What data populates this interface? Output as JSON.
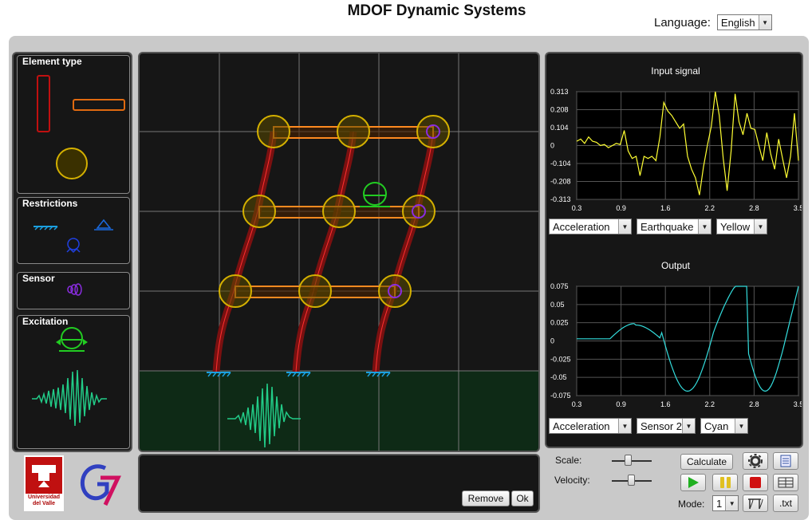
{
  "app": {
    "title": "MDOF Dynamic Systems"
  },
  "language": {
    "label": "Language:",
    "value": "English"
  },
  "left_panel": {
    "element_type": "Element type",
    "restrictions": "Restrictions",
    "sensor": "Sensor",
    "excitation": "Excitation"
  },
  "message_panel": {
    "remove_label": "Remove",
    "ok_label": "Ok"
  },
  "input_plot": {
    "title": "Input signal",
    "color": "#ffff33",
    "yticks": [
      "0.313",
      "0.208",
      "0.104",
      "0",
      "-0.104",
      "-0.208",
      "-0.313"
    ],
    "xticks": [
      "0.3",
      "0.9",
      "1.6",
      "2.2",
      "2.8",
      "3.5"
    ],
    "selects": [
      "Acceleration",
      "Earthquake",
      "Yellow"
    ]
  },
  "output_plot": {
    "title": "Output",
    "color": "#33dddd",
    "yticks": [
      "0.075",
      "0.05",
      "0.025",
      "0",
      "-0.025",
      "-0.05",
      "-0.075"
    ],
    "xticks": [
      "0.3",
      "0.9",
      "1.6",
      "2.2",
      "2.8",
      "3.5"
    ],
    "selects": [
      "Acceleration",
      "Sensor 2",
      "Cyan"
    ]
  },
  "controls": {
    "scale_label": "Scale:",
    "velocity_label": "Velocity:",
    "mode_label": "Mode:",
    "mode_value": "1",
    "calculate_label": "Calculate",
    "txt_label": ".txt"
  },
  "logos": {
    "uv_text": "Universidad del Valle"
  },
  "icons": [
    "settings-icon",
    "notes-icon",
    "play-icon",
    "pause-icon",
    "stop-icon",
    "table-icon",
    "mode-shape-icon"
  ]
}
